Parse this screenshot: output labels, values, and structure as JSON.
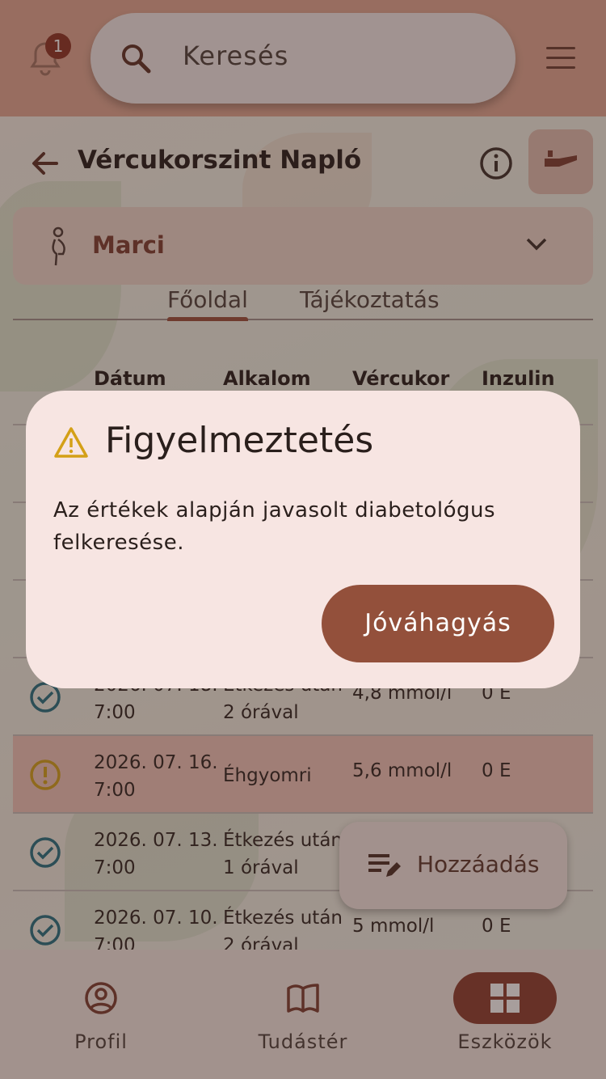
{
  "header": {
    "notification_count": "1",
    "search_placeholder": "Keresés"
  },
  "page": {
    "title": "Vércukorszint Napló",
    "person": "Marci",
    "tabs": [
      {
        "label": "Főoldal",
        "active": true
      },
      {
        "label": "Tájékoztatás",
        "active": false
      }
    ]
  },
  "table": {
    "columns": [
      "Dátum",
      "Alkalom",
      "Vércukor",
      "Inzulin"
    ],
    "rows": [
      {
        "status": "ok",
        "date_line1": "2026. 07. 18.",
        "date_line2": "7:00",
        "occasion_line1": "Étkezés után",
        "occasion_line2": "2 órával",
        "glucose": "4,8 mmol/l",
        "insulin": "0 E"
      },
      {
        "status": "warning",
        "date_line1": "2026. 07. 16.",
        "date_line2": "7:00",
        "occasion_line1": "Éhgyomri",
        "occasion_line2": "",
        "glucose": "5,6 mmol/l",
        "insulin": "0 E"
      },
      {
        "status": "ok",
        "date_line1": "2026. 07. 13.",
        "date_line2": "7:00",
        "occasion_line1": "Étkezés után",
        "occasion_line2": "1 órával",
        "glucose": "",
        "insulin": ""
      },
      {
        "status": "ok",
        "date_line1": "2026. 07. 10.",
        "date_line2": "7:00",
        "occasion_line1": "Étkezés után",
        "occasion_line2": "2 órával",
        "glucose": "5 mmol/l",
        "insulin": "0 E"
      }
    ]
  },
  "fab": {
    "label": "Hozzáadás"
  },
  "bottom_nav": [
    {
      "label": "Profil",
      "icon": "profile-icon",
      "active": false
    },
    {
      "label": "Tudástér",
      "icon": "book-icon",
      "active": false
    },
    {
      "label": "Eszközök",
      "icon": "grid-icon",
      "active": true
    }
  ],
  "dialog": {
    "title": "Figyelmeztetés",
    "body": "Az értékek alapján javasolt diabetológus felkeresése.",
    "confirm_label": "Jóváhagyás"
  },
  "colors": {
    "accent": "#93503b",
    "warning": "#d4a017",
    "ok": "#1f6e80"
  }
}
